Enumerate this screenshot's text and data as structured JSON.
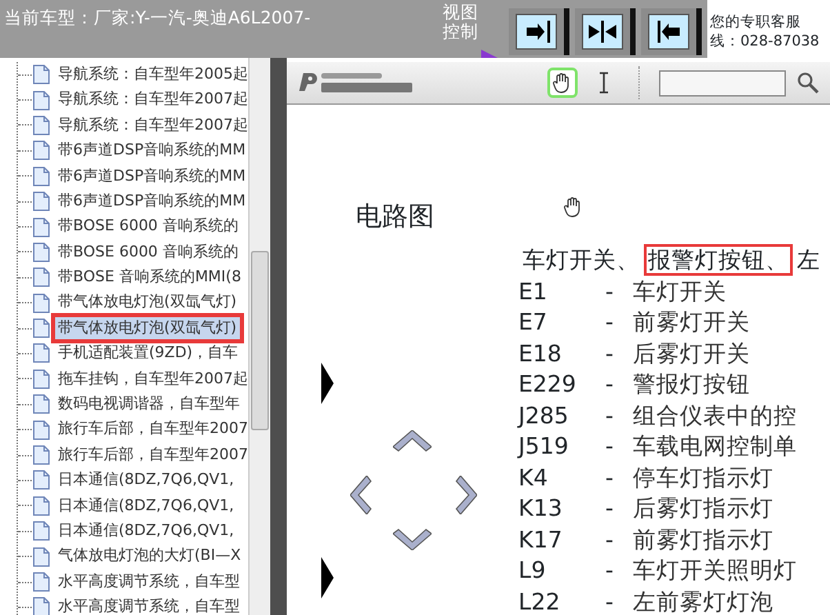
{
  "header": {
    "title": "当前车型：厂家:Y-一汽-奥迪A6L2007-",
    "view_control_label": "视图控制",
    "view_buttons": [
      {
        "kind": "right",
        "selected": false
      },
      {
        "kind": "both",
        "selected": false
      },
      {
        "kind": "left",
        "selected": false
      }
    ],
    "support_lines": [
      "您的专职客服",
      "线：028-87038"
    ]
  },
  "tree": {
    "items": [
      {
        "label": "导航系统：自车型年2005起",
        "selected": false
      },
      {
        "label": "导航系统：自车型年2007起",
        "selected": false
      },
      {
        "label": "导航系统：自车型年2007起",
        "selected": false
      },
      {
        "label": "带6声道DSP音响系统的MM",
        "selected": false
      },
      {
        "label": "带6声道DSP音响系统的MM",
        "selected": false
      },
      {
        "label": "带6声道DSP音响系统的MM",
        "selected": false
      },
      {
        "label": "带BOSE 6000 音响系统的",
        "selected": false
      },
      {
        "label": "带BOSE 6000 音响系统的",
        "selected": false
      },
      {
        "label": "带BOSE 音响系统的MMI(8",
        "selected": false
      },
      {
        "label": "带气体放电灯泡(双氙气灯)",
        "selected": false
      },
      {
        "label": "带气体放电灯泡(双氙气灯)",
        "selected": true
      },
      {
        "label": "手机适配装置(9ZD)，自车",
        "selected": false
      },
      {
        "label": "拖车挂钩，自车型年2007起",
        "selected": false
      },
      {
        "label": "数码电视调谐器，自车型年",
        "selected": false
      },
      {
        "label": "旅行车后部，自车型年2007",
        "selected": false
      },
      {
        "label": "旅行车后部，自车型年2007",
        "selected": false
      },
      {
        "label": "日本通信(8DZ,7Q6,QV1,",
        "selected": false
      },
      {
        "label": "日本通信(8DZ,7Q6,QV1,",
        "selected": false
      },
      {
        "label": "日本通信(8DZ,7Q6,QV1,",
        "selected": false
      },
      {
        "label": "气体放电灯泡的大灯(BI—X",
        "selected": false
      },
      {
        "label": "水平高度调节系统，自车型",
        "selected": false
      },
      {
        "label": "水平高度调节系统，自车型",
        "selected": false
      }
    ]
  },
  "viewer": {
    "tools": [
      {
        "kind": "hand",
        "selected": true
      },
      {
        "kind": "text",
        "selected": false
      }
    ],
    "document": {
      "title": "电路图",
      "heading": [
        {
          "text": "车灯开关、",
          "highlighted": false
        },
        {
          "text": "报警灯按钮、",
          "highlighted": true
        },
        {
          "text": "左",
          "highlighted": false
        }
      ],
      "legend": [
        {
          "code": "E1",
          "separator": "-",
          "description": "车灯开关"
        },
        {
          "code": "E7",
          "separator": "-",
          "description": "前雾灯开关"
        },
        {
          "code": "E18",
          "separator": "-",
          "description": "后雾灯开关"
        },
        {
          "code": "E229",
          "separator": "-",
          "description": "警报灯按钮"
        },
        {
          "code": "J285",
          "separator": "-",
          "description": "组合仪表中的控"
        },
        {
          "code": "J519",
          "separator": "-",
          "description": "车载电网控制单"
        },
        {
          "code": "K4",
          "separator": "-",
          "description": "停车灯指示灯"
        },
        {
          "code": "K13",
          "separator": "-",
          "description": "后雾灯指示灯"
        },
        {
          "code": "K17",
          "separator": "-",
          "description": "前雾灯指示灯"
        },
        {
          "code": "L9",
          "separator": "-",
          "description": "车灯开关照明灯"
        },
        {
          "code": "L22",
          "separator": "-",
          "description": "左前雾灯灯泡"
        }
      ]
    }
  }
}
